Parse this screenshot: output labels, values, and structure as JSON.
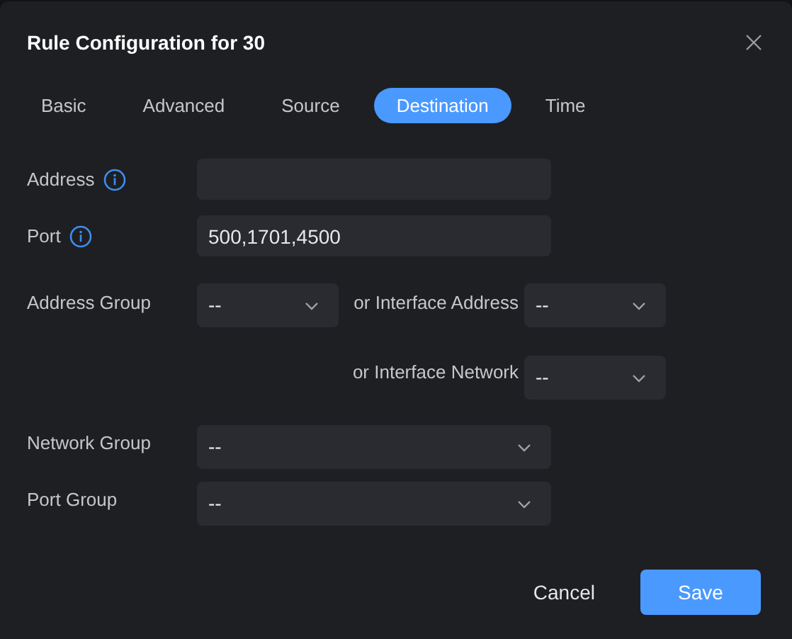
{
  "dialog": {
    "title": "Rule Configuration for 30"
  },
  "tabs": [
    {
      "label": "Basic",
      "selected": false
    },
    {
      "label": "Advanced",
      "selected": false
    },
    {
      "label": "Source",
      "selected": false
    },
    {
      "label": "Destination",
      "selected": true
    },
    {
      "label": "Time",
      "selected": false
    }
  ],
  "address": {
    "label": "Address"
  },
  "port": {
    "label": "Port",
    "value": "500,1701,4500"
  },
  "address_group": {
    "label": "Address Group",
    "value": "--"
  },
  "interface_address": {
    "label": "or Interface Address",
    "value": "--"
  },
  "interface_network": {
    "label": "or Interface Network",
    "value": "--"
  },
  "network_group": {
    "label": "Network Group",
    "value": "--"
  },
  "port_group": {
    "label": "Port Group",
    "value": "--"
  },
  "buttons": {
    "cancel": "Cancel",
    "save": "Save"
  }
}
